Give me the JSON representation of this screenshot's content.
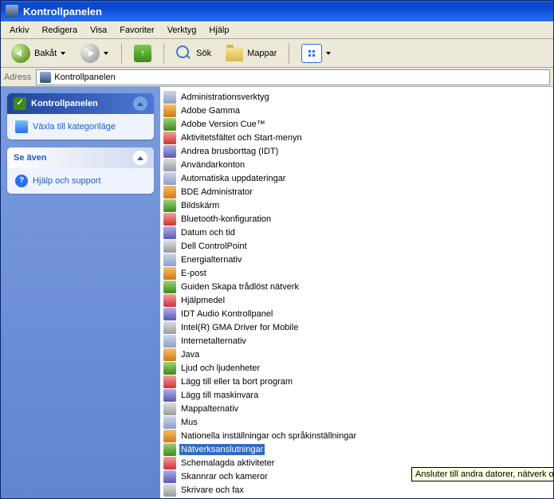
{
  "window": {
    "title": "Kontrollpanelen"
  },
  "menu": {
    "file": "Arkiv",
    "edit": "Redigera",
    "view": "Visa",
    "favorites": "Favoriter",
    "tools": "Verktyg",
    "help": "Hjälp"
  },
  "toolbar": {
    "back": "Bakåt",
    "search": "Sök",
    "folders": "Mappar"
  },
  "address": {
    "label": "Adress",
    "value": "Kontrollpanelen"
  },
  "sidebar": {
    "panel1": {
      "title": "Kontrollpanelen"
    },
    "link_switch": "Växla till kategoriläge",
    "panel2": {
      "title": "Se även"
    },
    "link_help": "Hjälp och support"
  },
  "tooltip": "Ansluter till andra datorer, nätverk och till Internet.",
  "items": [
    "Administrationsverktyg",
    "Adobe Gamma",
    "Adobe Version Cue™",
    "Aktivitetsfältet och Start-menyn",
    "Andrea brusborttag (IDT)",
    "Användarkonton",
    "Automatiska uppdateringar",
    "BDE Administrator",
    "Bildskärm",
    "Bluetooth-konfiguration",
    "Datum och tid",
    "Dell ControlPoint",
    "Energialternativ",
    "E-post",
    "Guiden Skapa trådlöst nätverk",
    "Hjälpmedel",
    "IDT Audio  Kontrollpanel",
    "Intel(R) GMA Driver for Mobile",
    "Internetalternativ",
    "Java",
    "Ljud och ljudenheter",
    "Lägg till eller ta bort program",
    "Lägg till maskinvara",
    "Mappalternativ",
    "Mus",
    "Nationella inställningar och språkinställningar",
    "Nätverksanslutningar",
    "Schemalagda aktiviteter",
    "Skannrar och kameror",
    "Skrivare och fax"
  ],
  "selected_index": 26
}
